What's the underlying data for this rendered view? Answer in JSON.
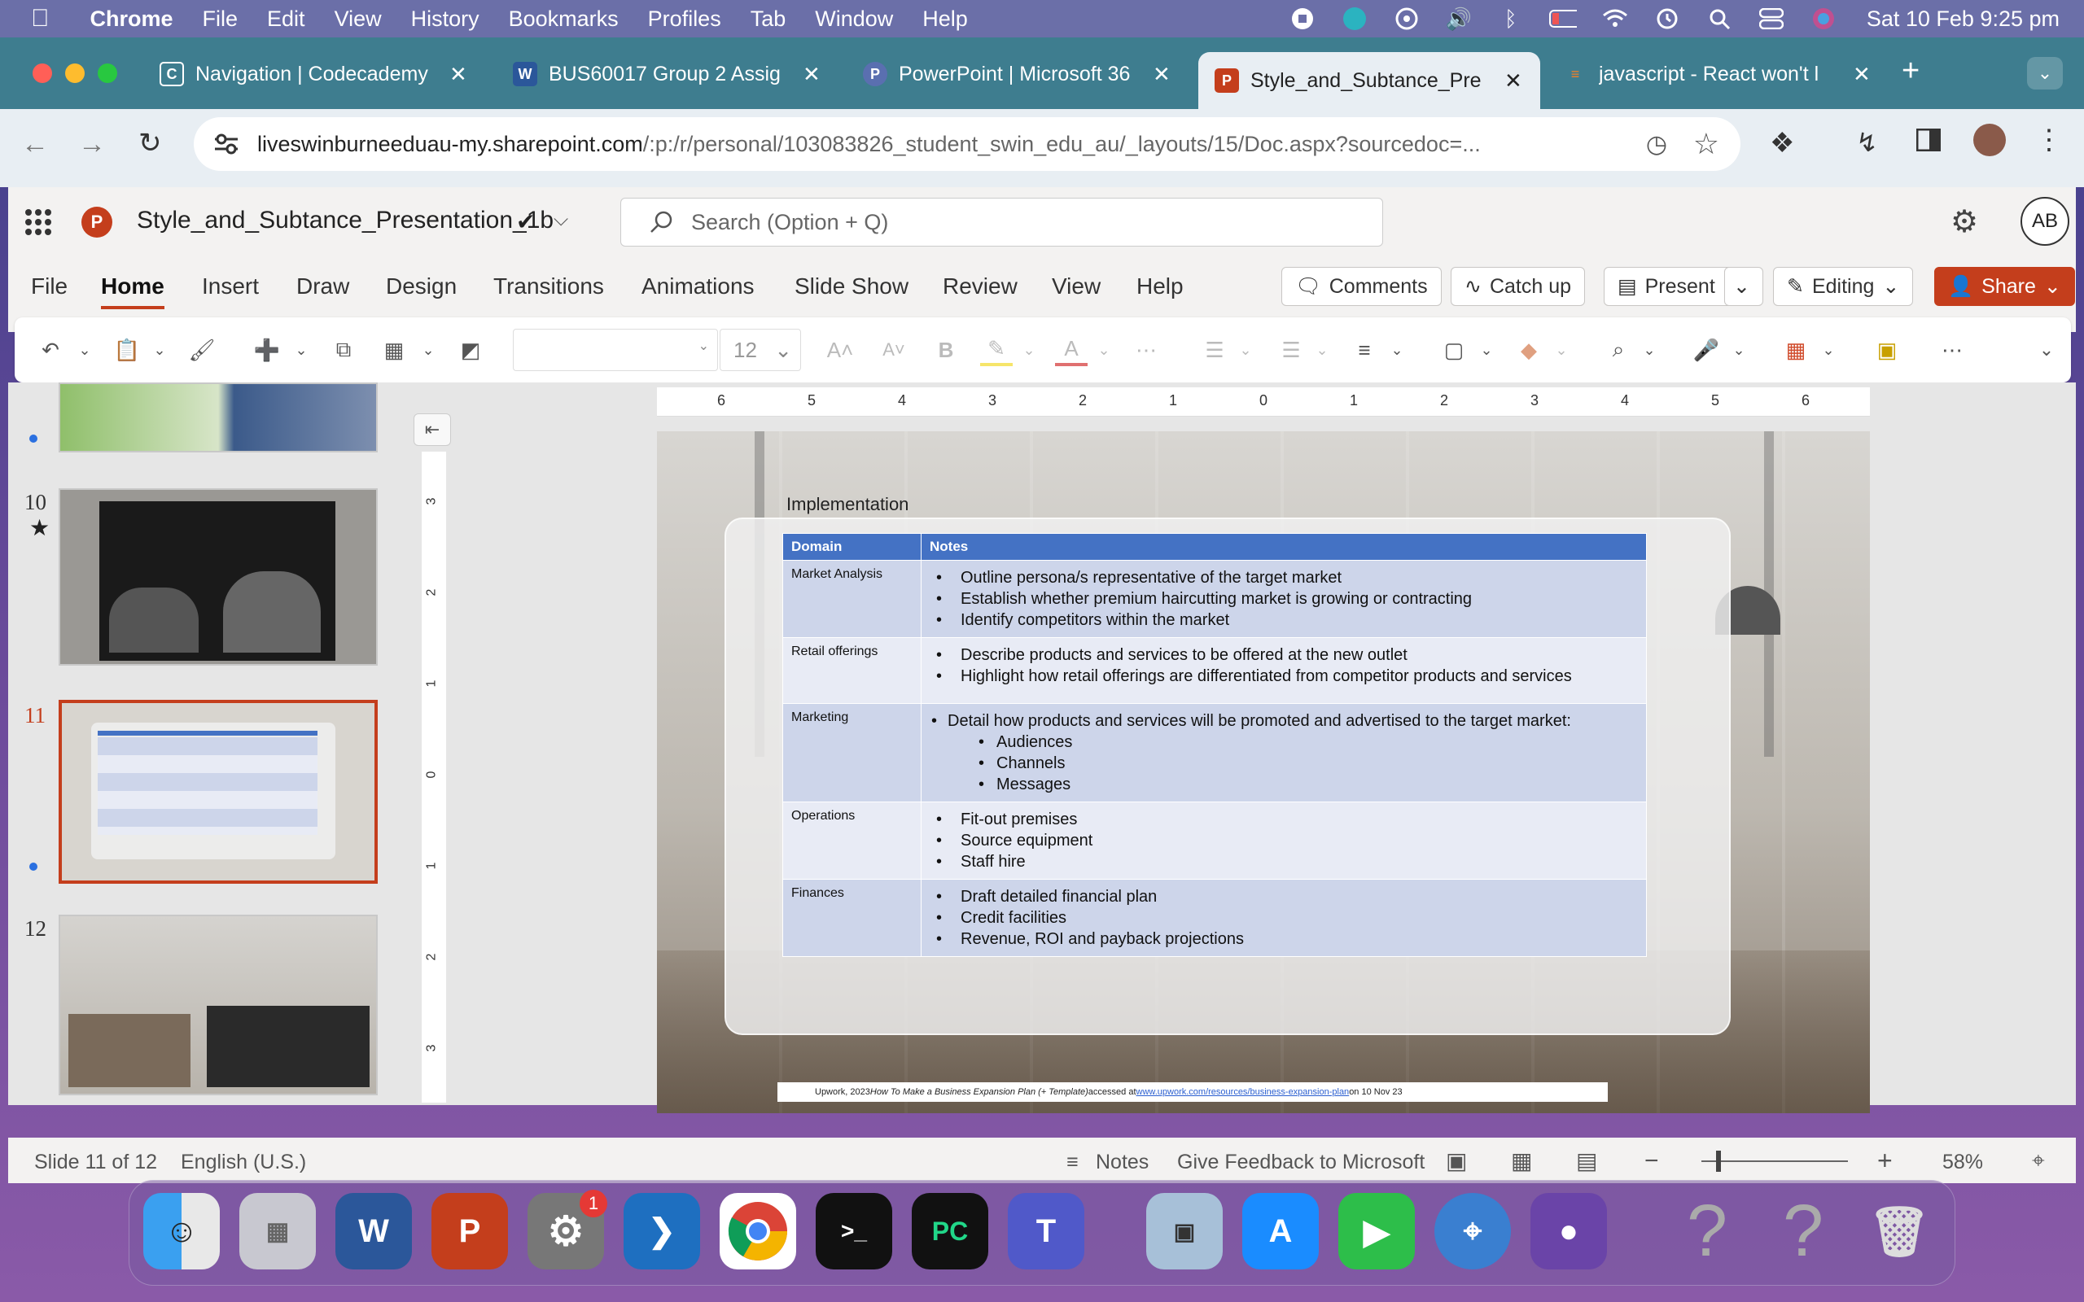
{
  "menubar": {
    "app_name": "Chrome",
    "items": [
      "File",
      "Edit",
      "View",
      "History",
      "Bookmarks",
      "Profiles",
      "Tab",
      "Window",
      "Help"
    ],
    "clock": "Sat 10 Feb  9:25 pm"
  },
  "tabs": [
    {
      "title": "Navigation | Codecademy",
      "favicon": "codecademy-icon"
    },
    {
      "title": "BUS60017 Group 2 Assig",
      "favicon": "word-icon"
    },
    {
      "title": "PowerPoint | Microsoft 36",
      "favicon": "powerpoint-icon"
    },
    {
      "title": "Style_and_Subtance_Pre",
      "favicon": "powerpoint-icon",
      "active": true
    },
    {
      "title": "javascript - React won't l",
      "favicon": "stackoverflow-icon"
    }
  ],
  "address": {
    "host": "liveswinburneeduau-my.sharepoint.com",
    "path": "/:p:/r/personal/103083826_student_swin_edu_au/_layouts/15/Doc.aspx?sourcedoc=..."
  },
  "office": {
    "doc_name": "Style_and_Subtance_Presentation_1b",
    "search_placeholder": "Search (Option + Q)",
    "avatar": "AB",
    "ribbon_tabs": [
      "File",
      "Home",
      "Insert",
      "Draw",
      "Design",
      "Transitions",
      "Animations",
      "Slide Show",
      "Review",
      "View",
      "Help"
    ],
    "active_tab": "Home",
    "comments": "Comments",
    "catch_up": "Catch up",
    "present": "Present",
    "editing": "Editing",
    "share": "Share",
    "font_size": "12"
  },
  "thumbnails": [
    {
      "num": "10"
    },
    {
      "num": "11"
    },
    {
      "num": "12"
    }
  ],
  "ruler_labels": [
    "6",
    "5",
    "4",
    "3",
    "2",
    "1",
    "0",
    "1",
    "2",
    "3",
    "4",
    "5",
    "6"
  ],
  "vruler_labels": [
    "3",
    "2",
    "1",
    "0",
    "1",
    "2",
    "3"
  ],
  "slide": {
    "title": "Implementation",
    "table_headers": [
      "Domain",
      "Notes"
    ],
    "rows": [
      {
        "domain": "Market Analysis",
        "notes": [
          "Outline persona/s representative of the target market",
          "Establish whether premium haircutting market is growing or contracting",
          "Identify competitors within the market"
        ]
      },
      {
        "domain": "Retail offerings",
        "notes": [
          "Describe products and services to be offered at the new outlet",
          "Highlight how retail offerings are differentiated from competitor products and services"
        ]
      },
      {
        "domain": "Marketing",
        "notes": [
          "Detail how products and services will be promoted and advertised to the target market:"
        ],
        "subnotes": [
          "Audiences",
          "Channels",
          "Messages"
        ]
      },
      {
        "domain": "Operations",
        "notes": [
          "Fit-out premises",
          "Source equipment",
          "Staff hire"
        ]
      },
      {
        "domain": "Finances",
        "notes": [
          "Draft detailed financial plan",
          "Credit facilities",
          "Revenue, ROI and payback projections"
        ]
      }
    ],
    "citation_prefix": "Upwork, 2023 ",
    "citation_title": "How To Make a Business Expansion Plan (+ Template)",
    "citation_mid": " accessed at ",
    "citation_link": "www.upwork.com/resources/business-expansion-plan",
    "citation_suffix": "  on 10 Nov 23"
  },
  "status": {
    "slide_counter": "Slide 11 of 12",
    "language": "English (U.S.)",
    "notes": "Notes",
    "feedback": "Give Feedback to Microsoft",
    "zoom": "58%"
  },
  "dock": {
    "badge": "1"
  },
  "colors": {
    "accent_red": "#c43e1c",
    "table_header": "#4472c4",
    "tab_bar": "#3e7d8f"
  }
}
